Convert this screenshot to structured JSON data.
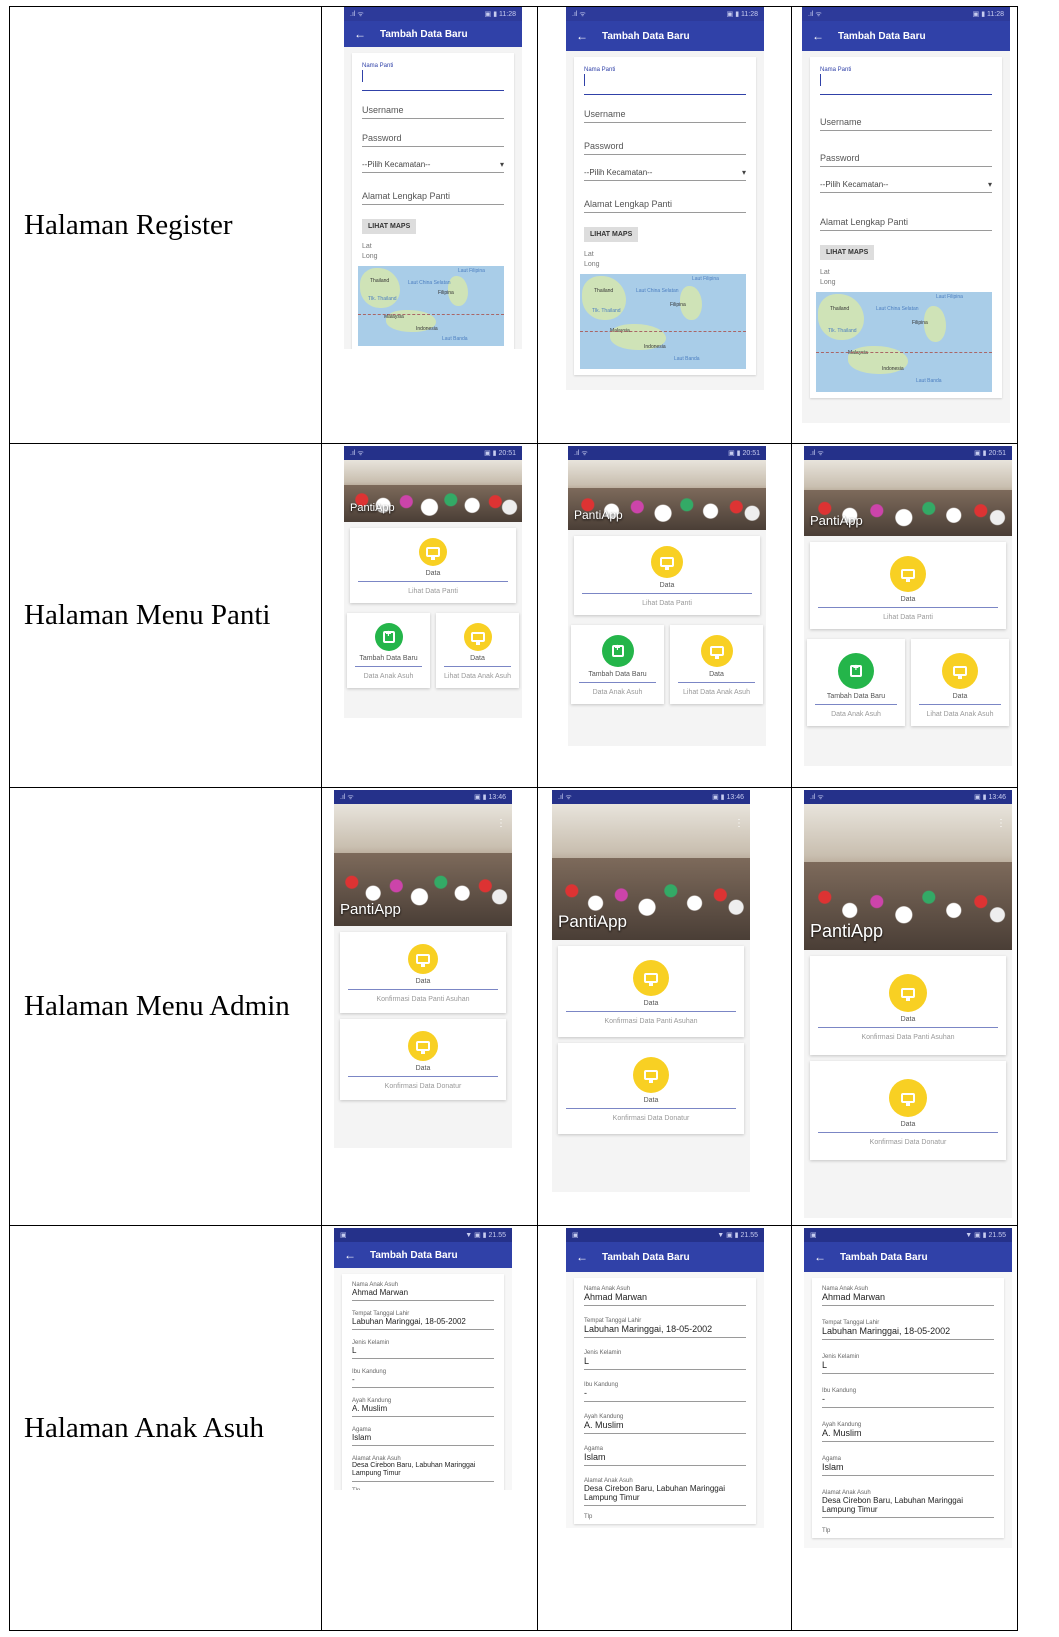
{
  "rows": [
    {
      "label": "Halaman Register"
    },
    {
      "label": "Halaman Menu Panti"
    },
    {
      "label": "Halaman Menu Admin"
    },
    {
      "label": "Halaman Anak Asuh"
    }
  ],
  "register": {
    "title": "Tambah Data Baru",
    "nama_label": "Nama Panti",
    "username": "Username",
    "password": "Password",
    "kecamatan": "--Pilih Kecamatan--",
    "alamat": "Alamat Lengkap Panti",
    "maps_button": "LIHAT MAPS",
    "lat": "Lat",
    "long": "Long",
    "map_labels": [
      "Thailand",
      "Laut China Selatan",
      "Filipina",
      "Laut Filipina",
      "Tlk. Thailand",
      "Malaysia",
      "Indonesia",
      "Laut Banda"
    ]
  },
  "menu_panti": {
    "app_title": "PantiApp",
    "card1_title": "Data",
    "card1_sub": "Lihat Data Panti",
    "card2_title": "Tambah Data Baru",
    "card2_sub": "Data Anak Asuh",
    "card3_title": "Data",
    "card3_sub": "Lihat Data Anak Asuh"
  },
  "menu_admin": {
    "app_title": "PantiApp",
    "card1_title": "Data",
    "card1_sub": "Konfirmasi Data Panti Asuhan",
    "card2_title": "Data",
    "card2_sub": "Konfirmasi Data Donatur"
  },
  "anak_asuh": {
    "title": "Tambah Data Baru",
    "status_time": "21.55",
    "fields": [
      {
        "label": "Nama Anak Asuh",
        "value": "Ahmad Marwan"
      },
      {
        "label": "Tempat Tanggal Lahir",
        "value": "Labuhan Maringgai, 18-05-2002"
      },
      {
        "label": "Jenis Kelamin",
        "value": "L"
      },
      {
        "label": "Ibu Kandung",
        "value": "-"
      },
      {
        "label": "Ayah Kandung",
        "value": "A. Muslim"
      },
      {
        "label": "Agama",
        "value": "Islam"
      },
      {
        "label": "Alamat Anak Asuh",
        "value": "Desa Cirebon Baru, Labuhan Maringgai Lampung Timur"
      },
      {
        "label": "Tlp",
        "value": ""
      }
    ]
  },
  "colors": {
    "primary": "#3041a8",
    "accent_yellow": "#f8d023",
    "accent_green": "#24b54a"
  }
}
